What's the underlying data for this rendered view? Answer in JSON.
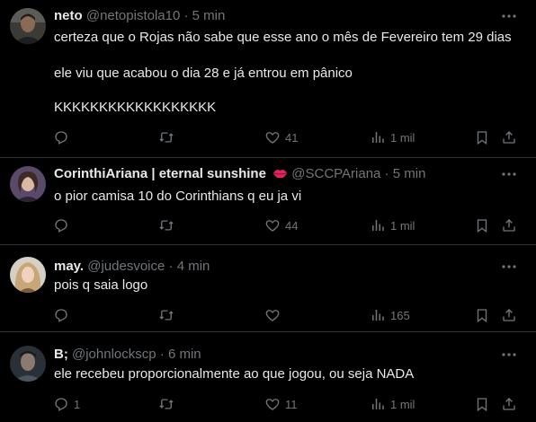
{
  "colors": {
    "background": "#000000",
    "text": "#e7e9ea",
    "secondary": "#71767b",
    "divider": "#2f3336"
  },
  "tweets": [
    {
      "name": "neto",
      "handle": "@netopistola10",
      "dot": "·",
      "time": "5 min",
      "text_lines": [
        "certeza que o Rojas não sabe que esse ano o mês de Fevereiro tem 29 dias",
        "ele viu que acabou o dia 28 e já entrou em pânico",
        "KKKKKKKKKKKKKKKKKK"
      ],
      "likes": "41",
      "views": "1 mil"
    },
    {
      "name": "CorinthiAriana | eternal sunshine",
      "name_emoji": "lips-emoji",
      "handle": "@SCCPAriana",
      "dot": "·",
      "time": "5 min",
      "text_lines": [
        "o pior camisa 10 do Corinthians q eu ja vi"
      ],
      "likes": "44",
      "views": "1 mil"
    },
    {
      "name": "may.",
      "handle": "@judesvoice",
      "dot": "·",
      "time": "4 min",
      "text_lines": [
        "pois q saia logo"
      ],
      "likes": "",
      "views": "165"
    },
    {
      "name": "B;",
      "handle": "@johnlockscp",
      "dot": "·",
      "time": "6 min",
      "text_lines": [
        "ele recebeu proporcionalmente ao que jogou, ou seja NADA"
      ],
      "replies": "1",
      "likes": "11",
      "views": "1 mil"
    }
  ]
}
